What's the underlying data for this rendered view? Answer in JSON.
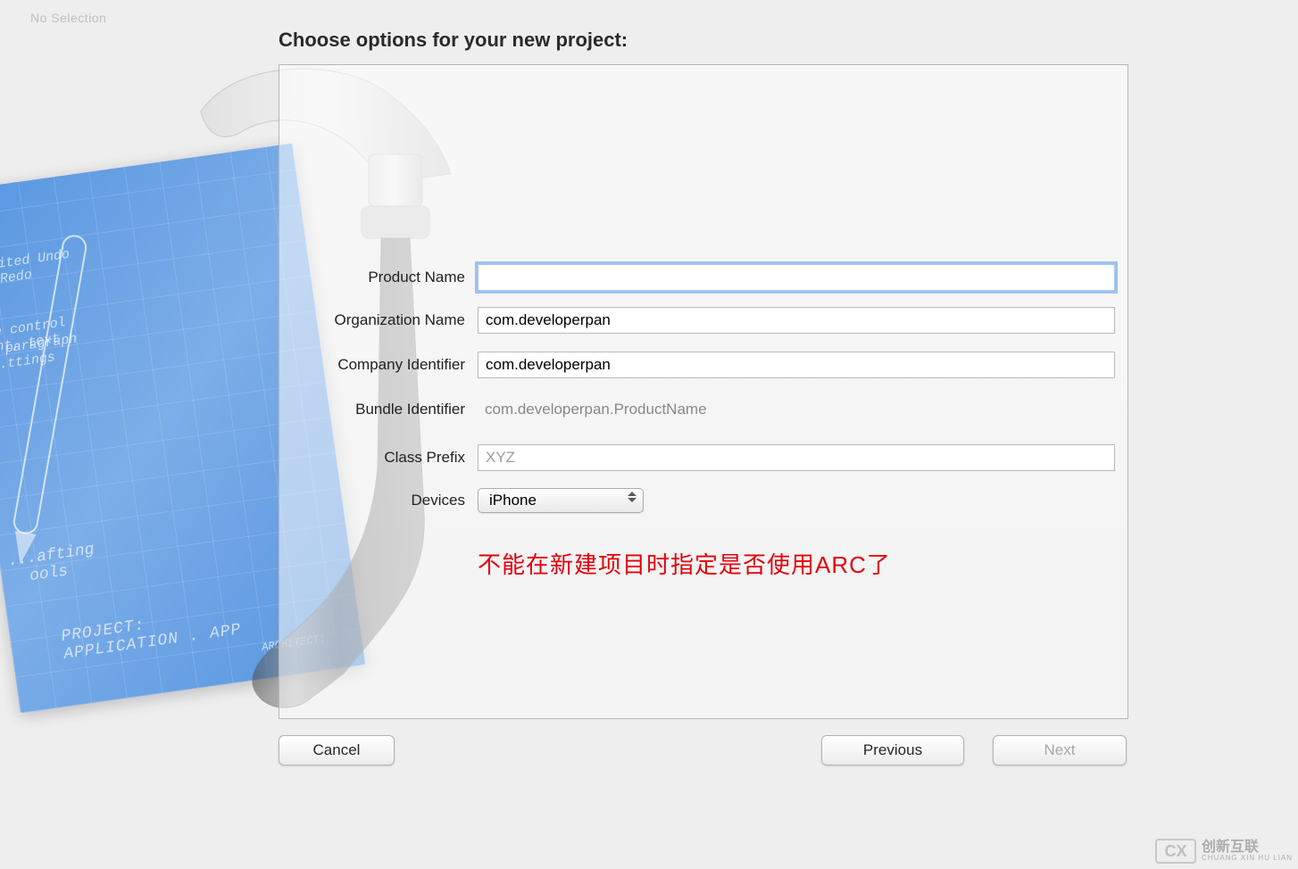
{
  "ghost_text": "No Selection",
  "dialog_title": "Choose options for your new project:",
  "fields": {
    "product_name": {
      "label": "Product Name",
      "value": "",
      "placeholder": ""
    },
    "organization_name": {
      "label": "Organization Name",
      "value": "com.developerpan",
      "placeholder": ""
    },
    "company_identifier": {
      "label": "Company Identifier",
      "value": "com.developerpan",
      "placeholder": ""
    },
    "bundle_identifier": {
      "label": "Bundle Identifier",
      "value": "com.developerpan.ProductName"
    },
    "class_prefix": {
      "label": "Class Prefix",
      "value": "",
      "placeholder": "XYZ"
    },
    "devices": {
      "label": "Devices",
      "value": "iPhone"
    }
  },
  "annotation": "不能在新建项目时指定是否使用ARC了",
  "buttons": {
    "cancel": "Cancel",
    "previous": "Previous",
    "next": "Next"
  },
  "blueprint": {
    "undo": "...ited Undo\n & Redo",
    "control": "..e control\n..nt, text",
    "para": "& paragraph\n..ttings",
    "tools": "...afting\n  ools",
    "project": "PROJECT:",
    "app": "APPLICATION . APP",
    "architect": "ARCHITECT:"
  },
  "watermark": {
    "logo": "CX",
    "line1": "创新互联",
    "line2": "CHUANG XIN HU LIAN"
  }
}
